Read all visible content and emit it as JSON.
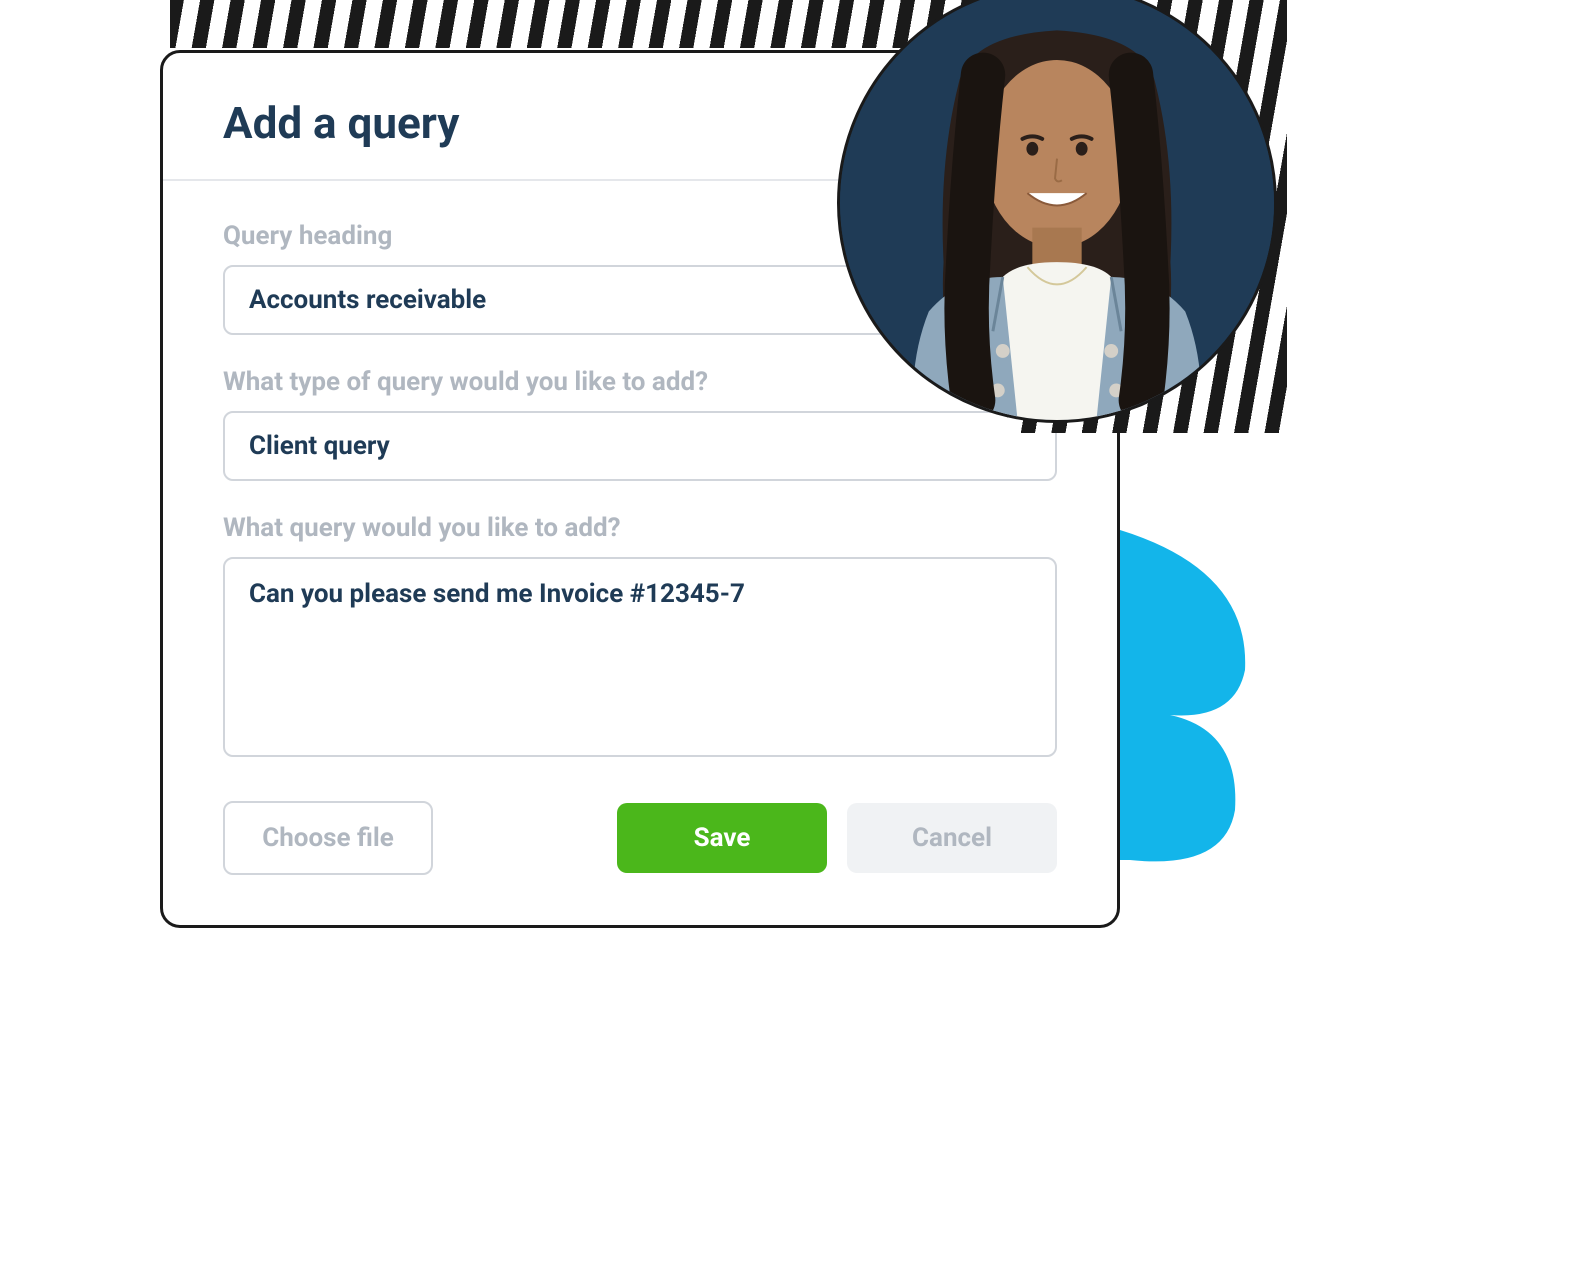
{
  "modal": {
    "title": "Add a query",
    "fields": {
      "heading": {
        "label": "Query heading",
        "value": "Accounts receivable"
      },
      "type": {
        "label": "What type of query would you like to add?",
        "value": "Client query"
      },
      "query": {
        "label": "What query would you like to add?",
        "value": "Can you please send me Invoice #12345-7"
      }
    },
    "buttons": {
      "choose_file": "Choose file",
      "save": "Save",
      "cancel": "Cancel"
    }
  }
}
